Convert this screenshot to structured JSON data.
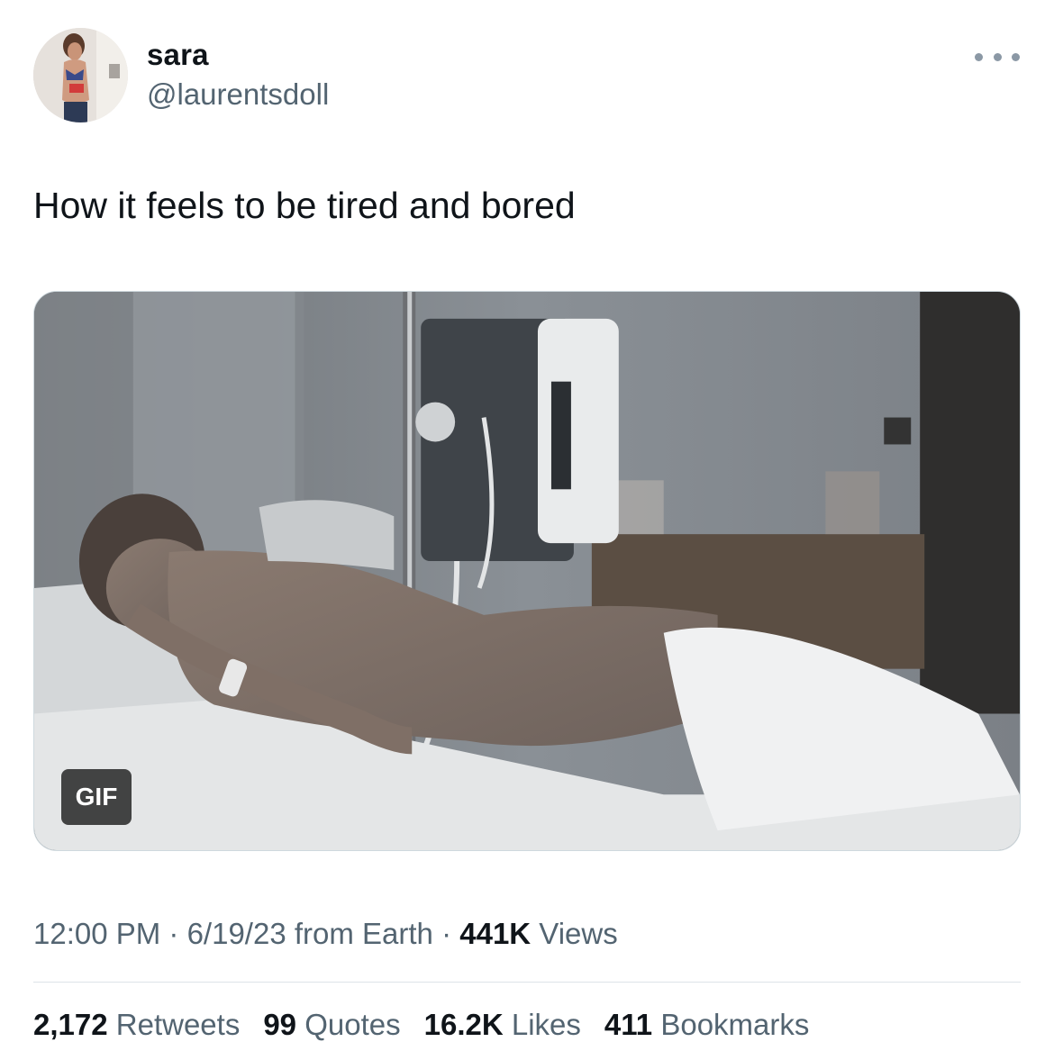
{
  "user": {
    "display_name": "sara",
    "handle": "@laurentsdoll",
    "avatar_icon": "profile-photo"
  },
  "more_icon": "more-horizontal-icon",
  "tweet": {
    "text": "How it feels to be tired and bored",
    "media_badge": "GIF"
  },
  "meta": {
    "time": "12:00 PM",
    "sep1": " · ",
    "date": "6/19/23",
    "source": " from Earth",
    "sep2": " · ",
    "views_count": "441K",
    "views_label": " Views"
  },
  "stats": [
    {
      "count": "2,172",
      "label": " Retweets"
    },
    {
      "count": "99",
      "label": " Quotes"
    },
    {
      "count": "16.2K",
      "label": " Likes"
    },
    {
      "count": "411",
      "label": " Bookmarks"
    }
  ],
  "colors": {
    "text_primary": "#0f1419",
    "text_secondary": "#536471",
    "divider": "#dde3e8"
  }
}
